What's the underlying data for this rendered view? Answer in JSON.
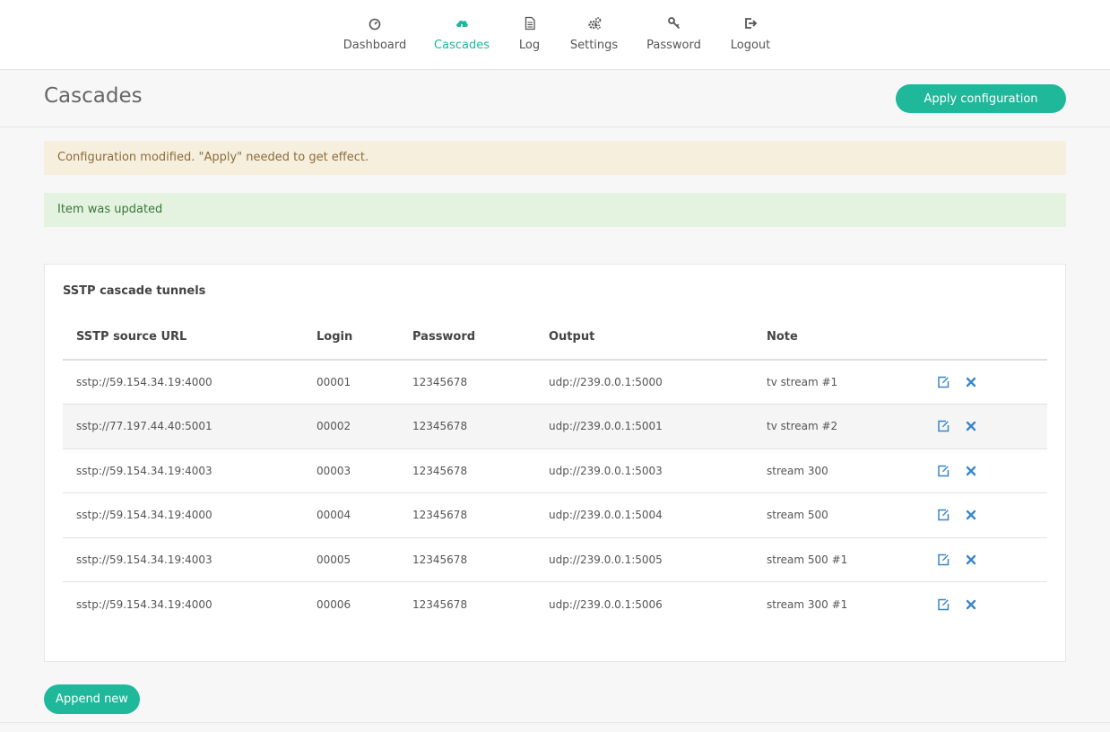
{
  "nav": {
    "items": [
      {
        "label": "Dashboard",
        "icon": "gauge-icon"
      },
      {
        "label": "Cascades",
        "icon": "cloud-icon"
      },
      {
        "label": "Log",
        "icon": "document-icon"
      },
      {
        "label": "Settings",
        "icon": "gears-icon"
      },
      {
        "label": "Password",
        "icon": "key-icon"
      },
      {
        "label": "Logout",
        "icon": "logout-icon"
      }
    ],
    "active": "Cascades"
  },
  "header": {
    "title": "Cascades",
    "apply_label": "Apply configuration"
  },
  "alerts": {
    "warning": "Configuration modified. \"Apply\" needed to get effect.",
    "success": "Item was updated"
  },
  "panel": {
    "title": "SSTP cascade tunnels",
    "columns": [
      "SSTP source URL",
      "Login",
      "Password",
      "Output",
      "Note"
    ],
    "rows": [
      {
        "url": "sstp://59.154.34.19:4000",
        "login": "00001",
        "password": "12345678",
        "output": "udp://239.0.0.1:5000",
        "note": "tv stream #1"
      },
      {
        "url": "sstp://77.197.44.40:5001",
        "login": "00002",
        "password": "12345678",
        "output": "udp://239.0.0.1:5001",
        "note": "tv stream #2"
      },
      {
        "url": "sstp://59.154.34.19:4003",
        "login": "00003",
        "password": "12345678",
        "output": "udp://239.0.0.1:5003",
        "note": "stream 300"
      },
      {
        "url": "sstp://59.154.34.19:4000",
        "login": "00004",
        "password": "12345678",
        "output": "udp://239.0.0.1:5004",
        "note": "stream 500"
      },
      {
        "url": "sstp://59.154.34.19:4003",
        "login": "00005",
        "password": "12345678",
        "output": "udp://239.0.0.1:5005",
        "note": "stream 500 #1"
      },
      {
        "url": "sstp://59.154.34.19:4000",
        "login": "00006",
        "password": "12345678",
        "output": "udp://239.0.0.1:5006",
        "note": "stream 300 #1"
      }
    ]
  },
  "append_label": "Append new",
  "colors": {
    "accent": "#1fb89a",
    "action_icon": "#3a86c8",
    "warning_bg": "#f7efdd",
    "success_bg": "#e4f2e0"
  }
}
